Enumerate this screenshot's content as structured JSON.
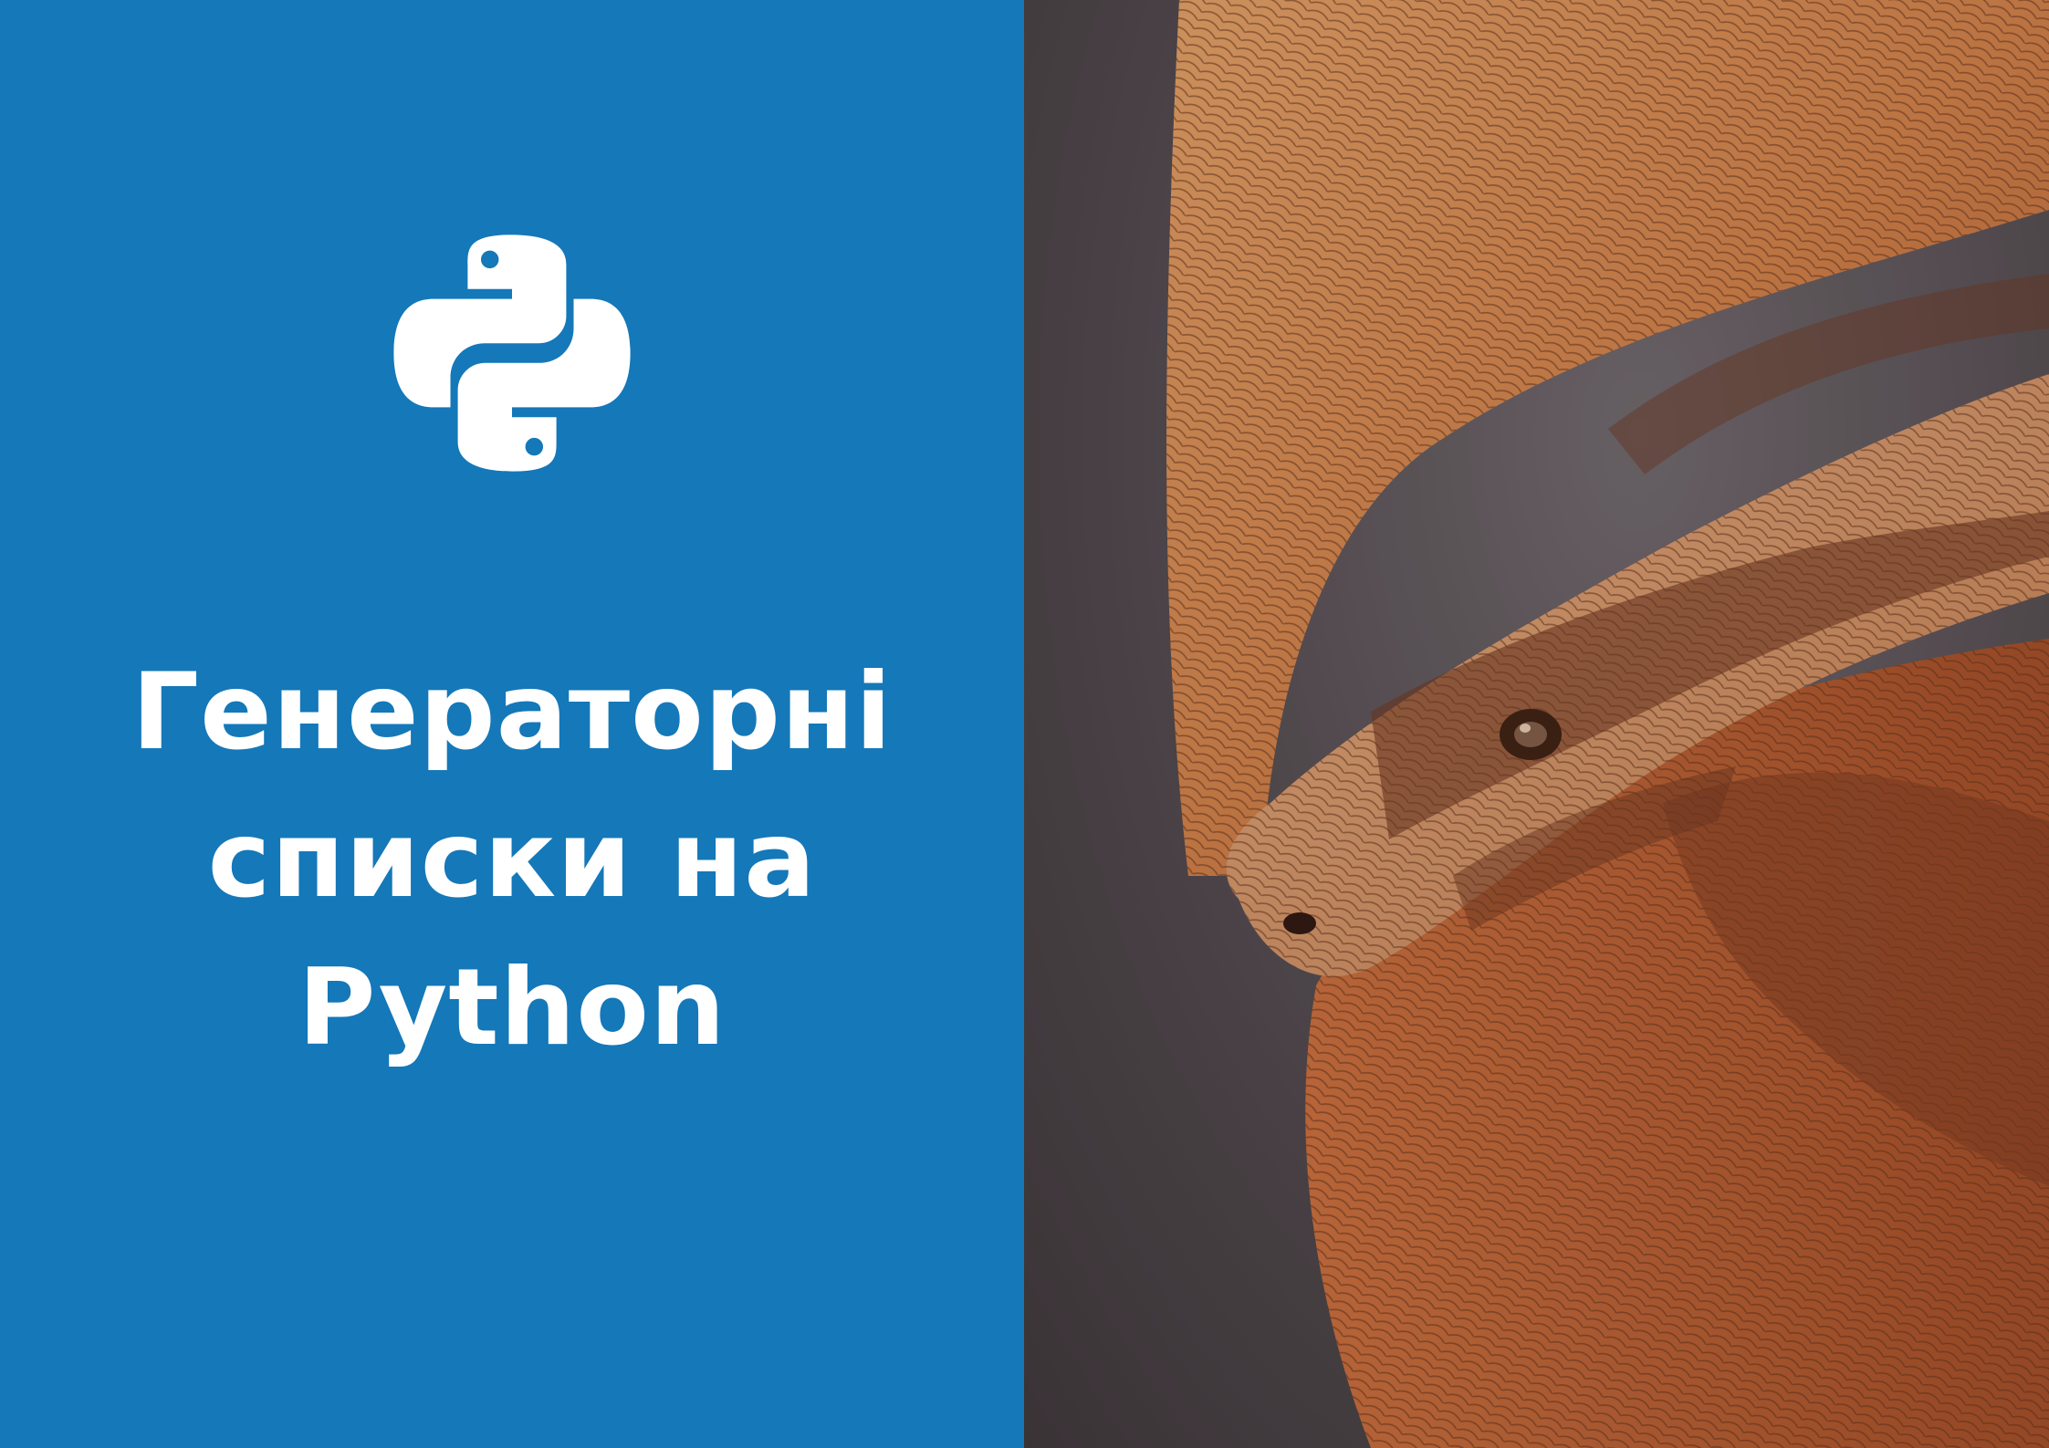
{
  "title": {
    "lines": [
      "Генераторні",
      "списки на",
      "Python"
    ]
  },
  "icons": {
    "logo": "python-logo-icon"
  },
  "photo": {
    "subject": "snake-photo"
  },
  "colors": {
    "left_background": "#1478b9",
    "text": "#ffffff"
  }
}
